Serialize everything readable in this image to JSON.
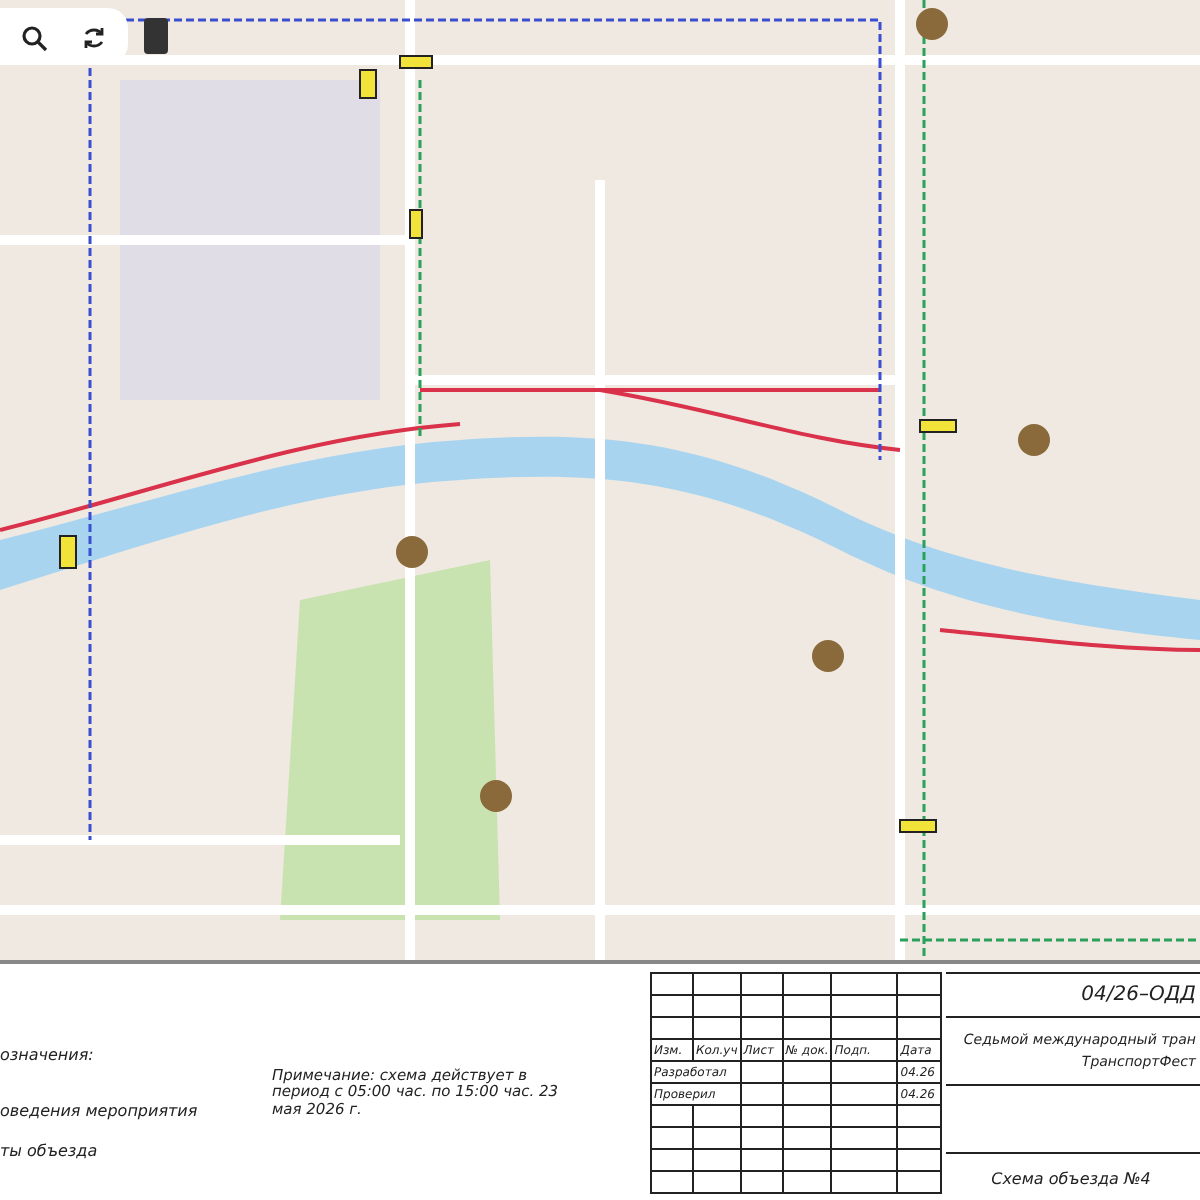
{
  "legend": {
    "title": "означения:",
    "items": [
      "оведения мероприятия",
      "ты объезда"
    ]
  },
  "note": "Примечание: схема действует в период с 05:00 час. по 15:00 час. 23 мая 2026 г.",
  "stamp": {
    "columns": [
      "Изм.",
      "Кол.уч",
      "Лист",
      "№ док.",
      "Подп.",
      "Дата"
    ],
    "rows": [
      {
        "role": "Разработал",
        "date": "04.26"
      },
      {
        "role": "Проверил",
        "date": "04.26"
      }
    ],
    "code": "04/26–ОДД",
    "project": [
      "Седьмой международный тран",
      "ТранспортФест"
    ],
    "sheet_title": "Схема объезда №4"
  }
}
